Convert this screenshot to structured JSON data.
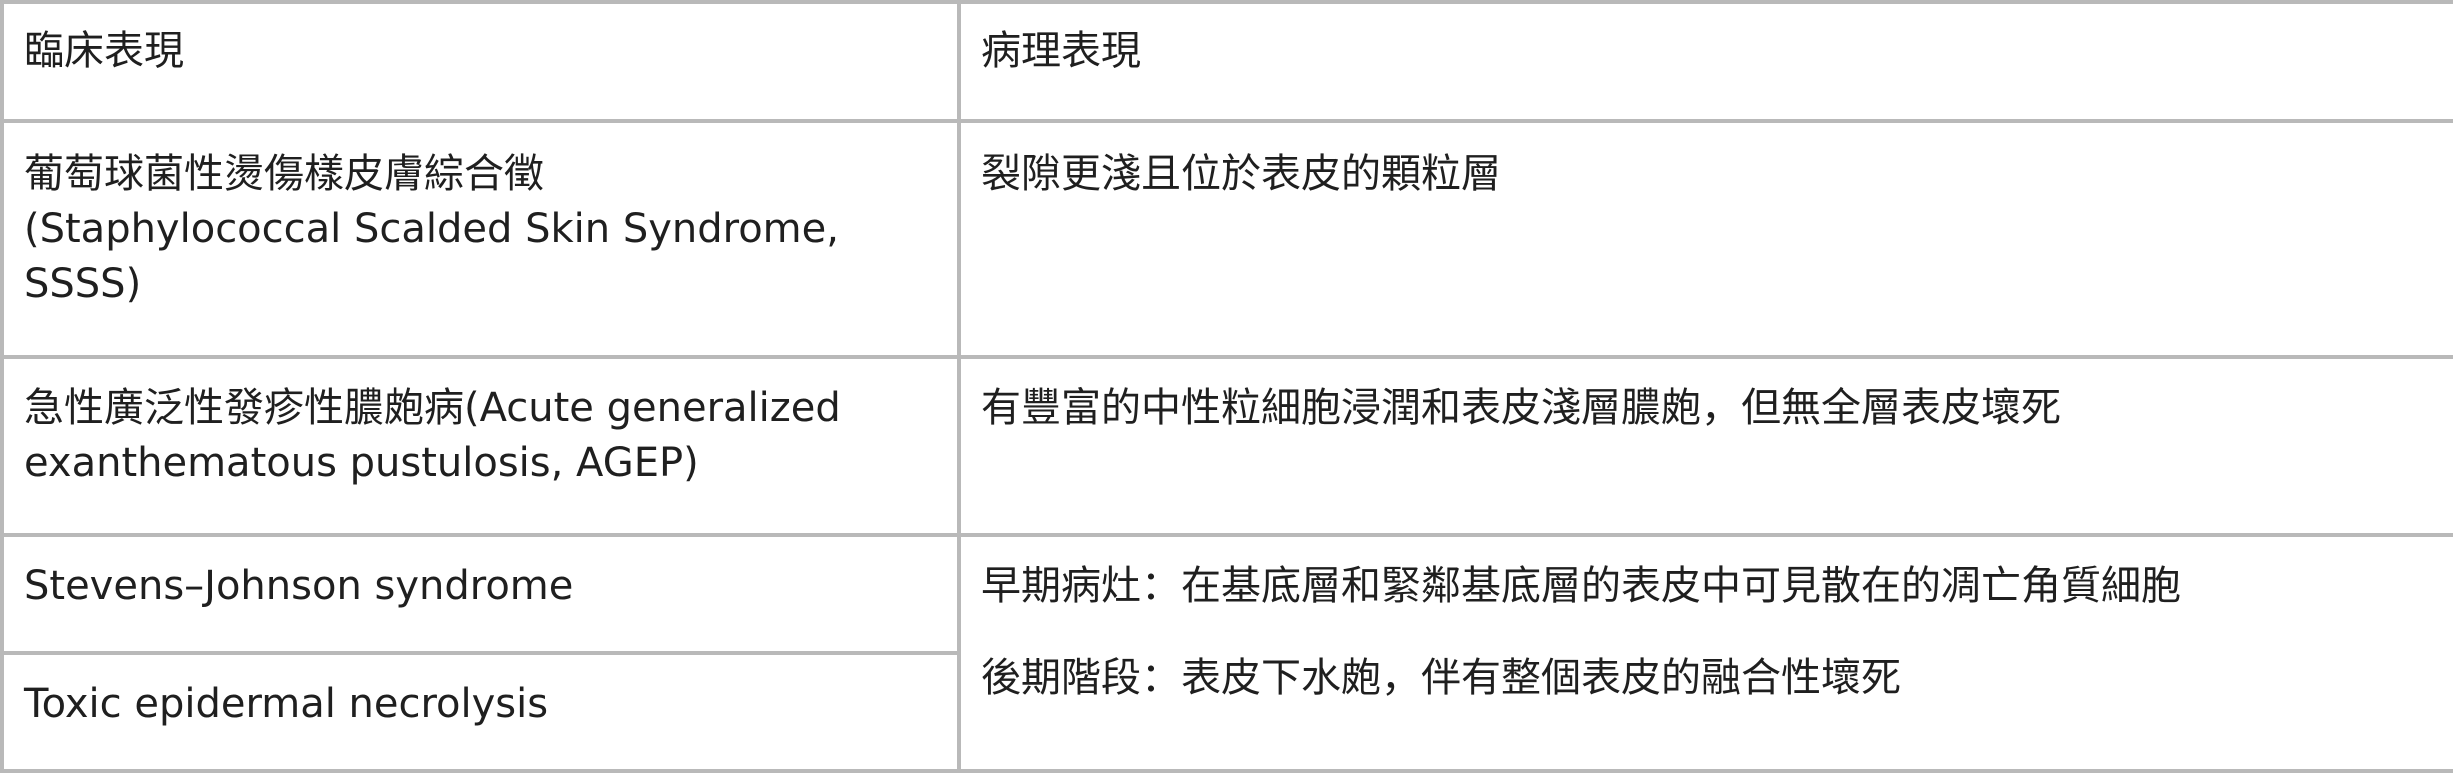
{
  "table": {
    "header": {
      "col1": "臨床表現",
      "col2": "病理表現"
    },
    "rows": [
      {
        "clinical": [
          "葡萄球菌性燙傷樣皮膚綜合徵",
          "(Staphylococcal Scalded Skin Syndrome,",
          "SSSS)"
        ],
        "pathology": [
          "裂隙更淺且位於表皮的顆粒層"
        ]
      },
      {
        "clinical": [
          "急性廣泛性發疹性膿皰病(Acute generalized",
          "exanthematous pustulosis, AGEP)"
        ],
        "pathology": [
          "有豐富的中性粒細胞浸潤和表皮淺層膿皰，但無全層表皮壞死"
        ]
      },
      {
        "clinical": [
          "Stevens–Johnson syndrome"
        ],
        "pathology": []
      },
      {
        "clinical": [
          "Toxic epidermal necrolysis"
        ],
        "pathology": []
      }
    ],
    "merged_pathology": [
      "早期病灶：在基底層和緊鄰基底層的表皮中可見散在的凋亡角質細胞",
      "後期階段：表皮下水皰，伴有整個表皮的融合性壞死"
    ]
  }
}
